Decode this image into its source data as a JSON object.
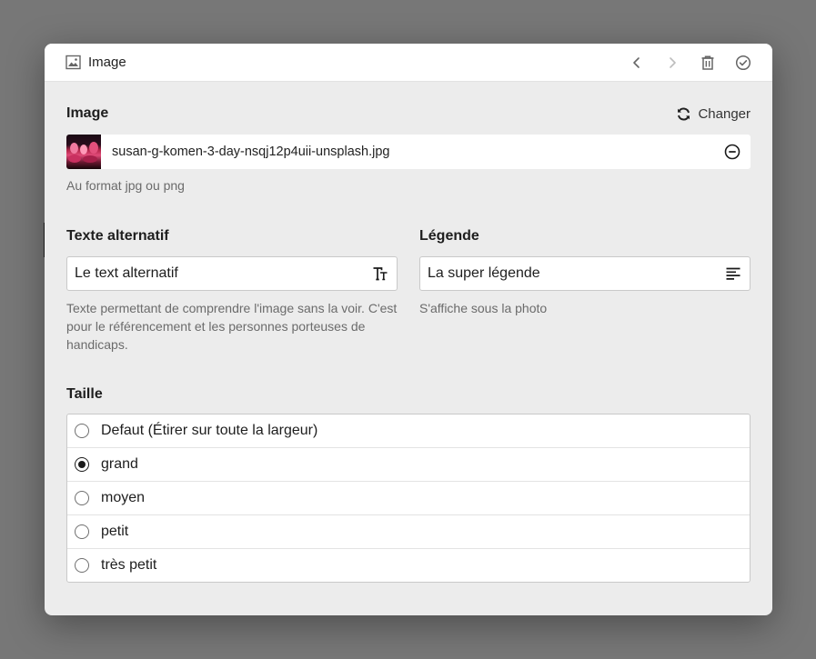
{
  "dialog": {
    "title": "Image",
    "toolbar": {
      "prev_icon": "chevron-left-icon",
      "next_icon": "chevron-right-icon",
      "delete_icon": "trash-icon",
      "confirm_icon": "check-circle-icon"
    }
  },
  "image_section": {
    "label": "Image",
    "change_label": "Changer",
    "change_icon": "refresh-icon",
    "file_name": "susan-g-komen-3-day-nsqj12p4uii-unsplash.jpg",
    "remove_icon": "minus-circle-icon",
    "help": "Au format jpg ou png"
  },
  "alt_text": {
    "label": "Texte alternatif",
    "value": "Le text alternatif",
    "icon": "text-size-icon",
    "help": "Texte permettant de comprendre l'image sans la voir. C'est pour le référencement et les personnes porteuses de handicaps."
  },
  "caption": {
    "label": "Légende",
    "value": "La super légende",
    "icon": "align-left-icon",
    "help": "S'affiche sous la photo"
  },
  "size": {
    "label": "Taille",
    "options": [
      {
        "label": "Defaut (Étirer sur toute la largeur)",
        "checked": false
      },
      {
        "label": "grand",
        "checked": true
      },
      {
        "label": "moyen",
        "checked": false
      },
      {
        "label": "petit",
        "checked": false
      },
      {
        "label": "très petit",
        "checked": false
      }
    ]
  }
}
